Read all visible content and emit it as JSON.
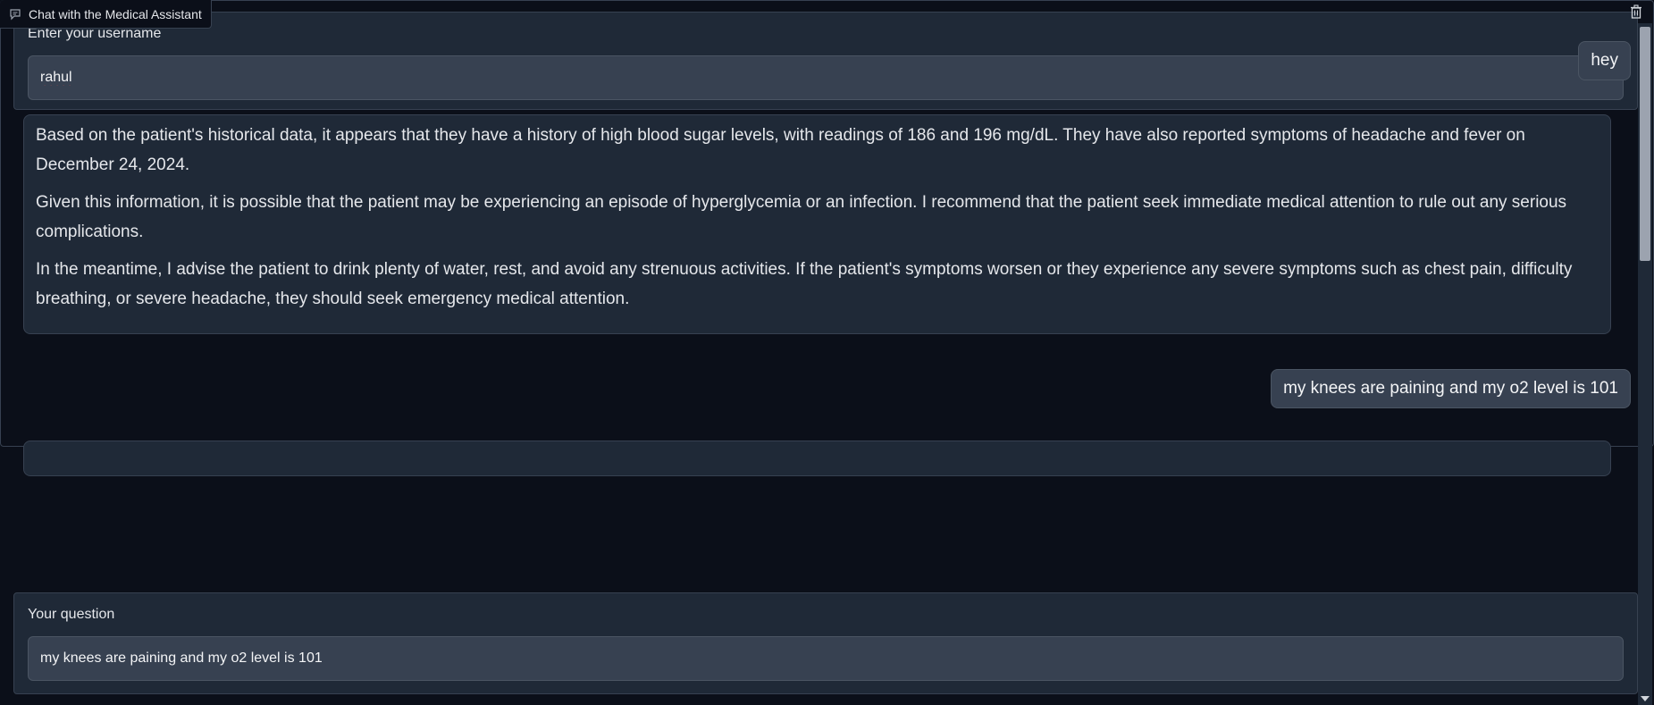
{
  "username": {
    "label": "Enter your username",
    "value": "rahul"
  },
  "chat": {
    "label": "Chat with the Medical Assistant",
    "clear_icon": "trash-icon",
    "chat_icon": "chat-bubble-icon",
    "messages": [
      {
        "role": "user",
        "text": "hey"
      },
      {
        "role": "assistant",
        "paragraphs": [
          "Based on the patient's historical data, it appears that they have a history of high blood sugar levels, with readings of 186 and 196 mg/dL. They have also reported symptoms of headache and fever on December 24, 2024.",
          "Given this information, it is possible that the patient may be experiencing an episode of hyperglycemia or an infection. I recommend that the patient seek immediate medical attention to rule out any serious complications.",
          "In the meantime, I advise the patient to drink plenty of water, rest, and avoid any strenuous activities. If the patient's symptoms worsen or they experience any severe symptoms such as chest pain, difficulty breathing, or severe headache, they should seek emergency medical attention."
        ]
      },
      {
        "role": "user",
        "text": "my knees are paining and my o2 level is 101"
      }
    ]
  },
  "question": {
    "label": "Your question",
    "value": "my knees are paining and my o2 level is 101"
  }
}
